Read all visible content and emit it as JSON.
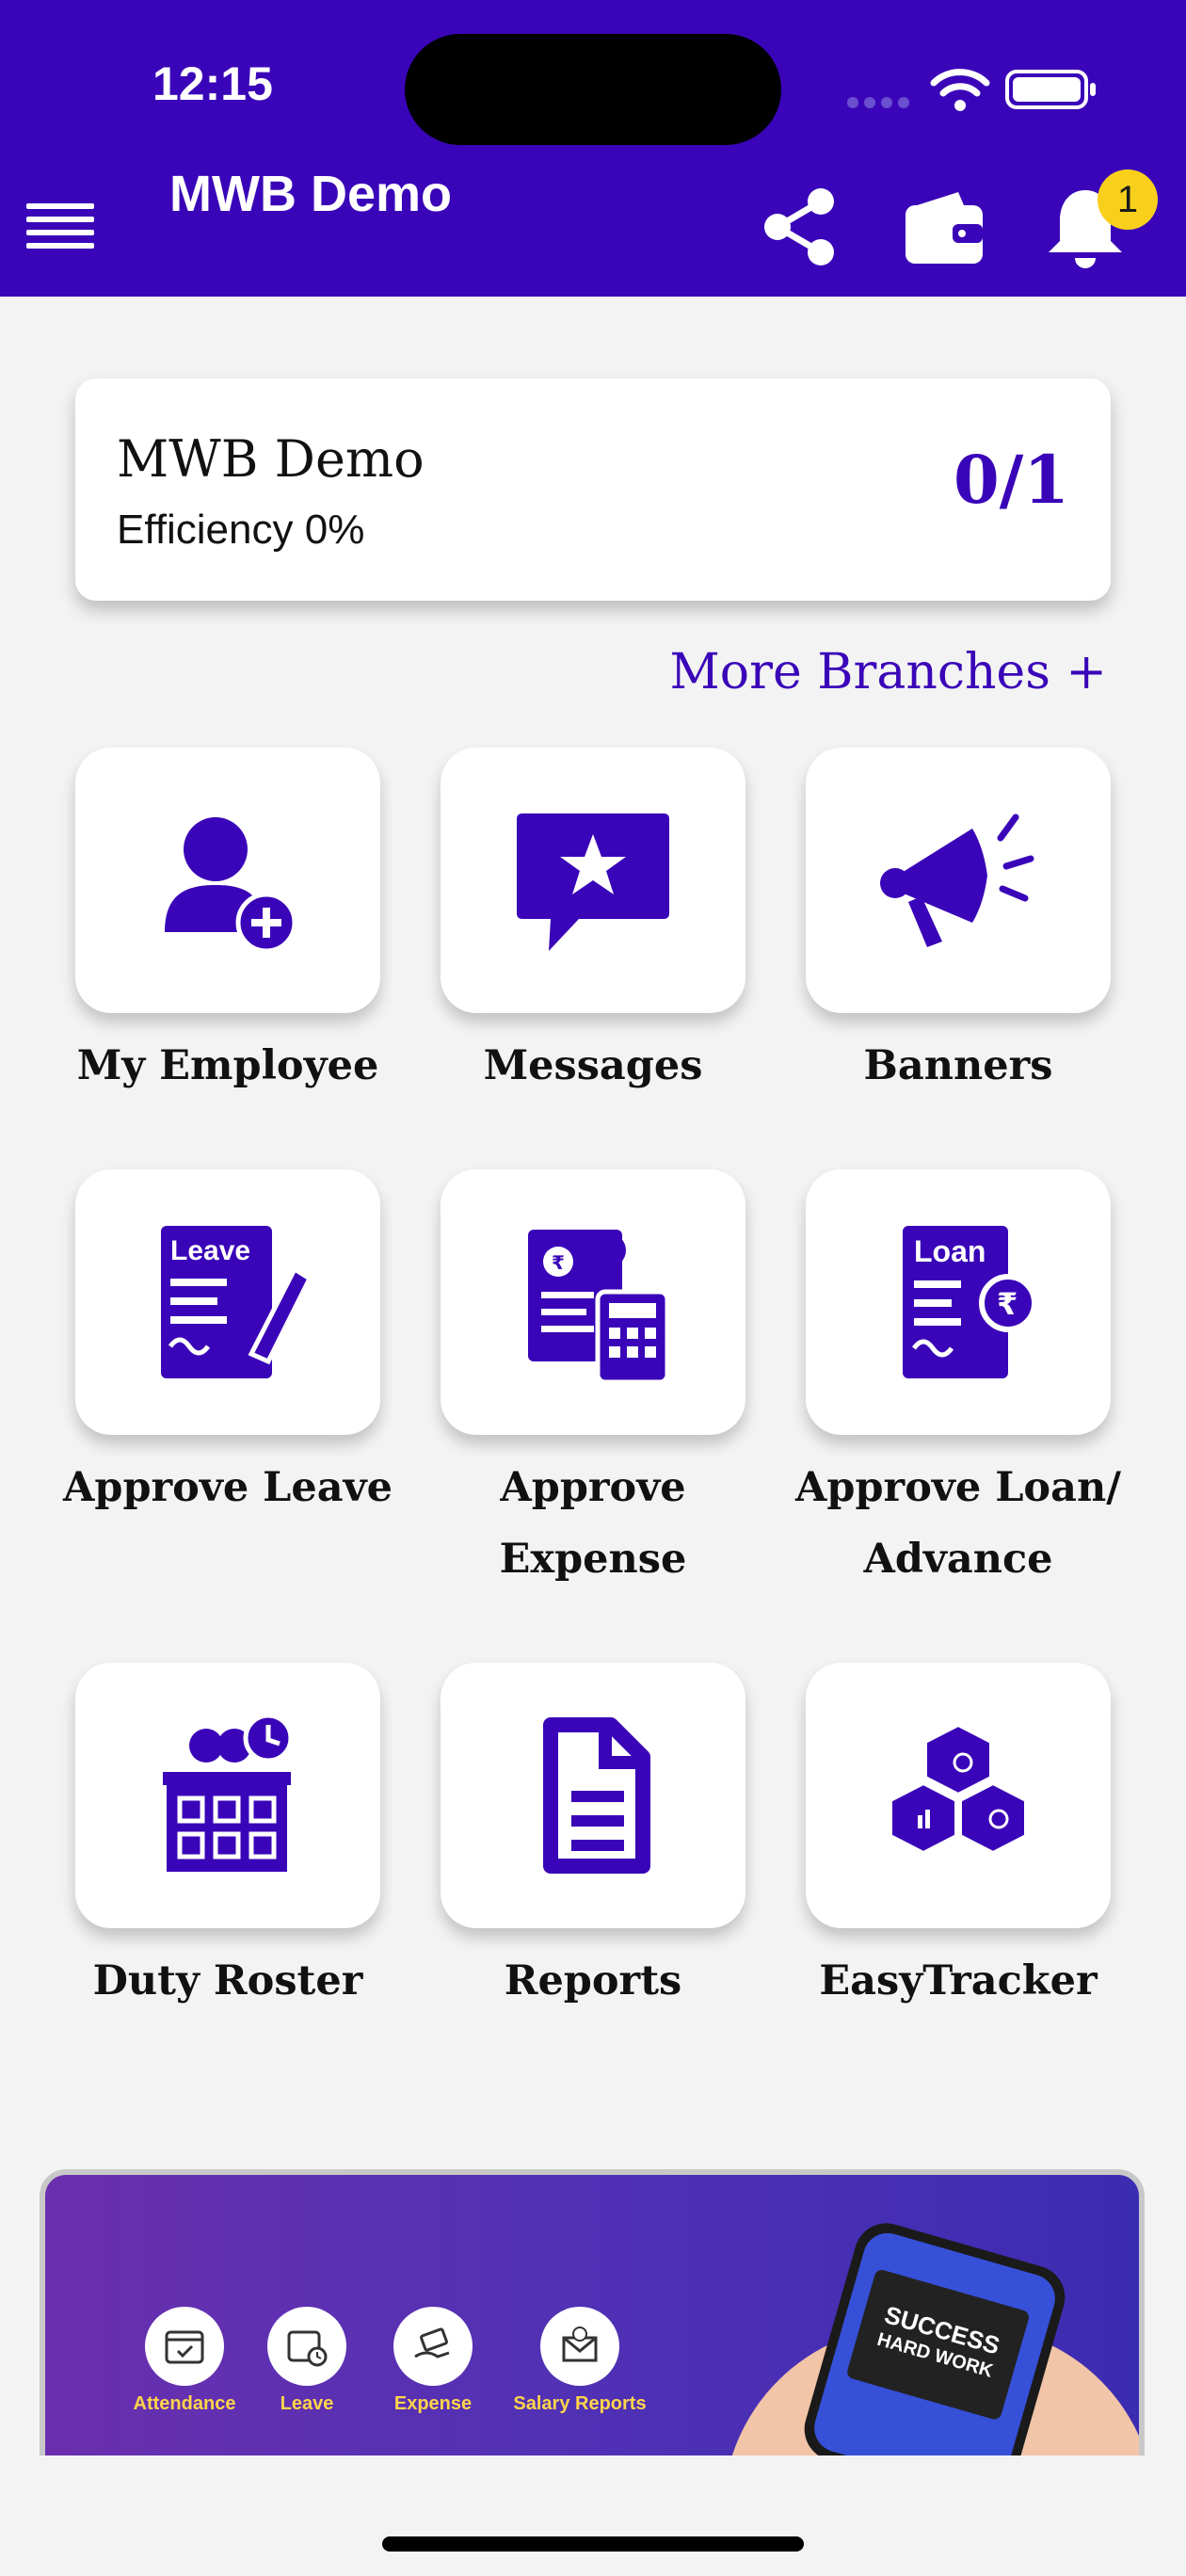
{
  "status_bar": {
    "time": "12:15"
  },
  "header": {
    "title": "MWB Demo",
    "notification_count": "1",
    "icons": [
      "menu-icon",
      "share-icon",
      "wallet-icon",
      "bell-icon"
    ]
  },
  "branch": {
    "name": "MWB Demo",
    "efficiency": "Efficiency 0%",
    "count": "0/1"
  },
  "more_branches": "More Branches +",
  "tiles": [
    {
      "label": "My Employee",
      "icon": "add-employee-icon"
    },
    {
      "label": "Messages",
      "icon": "message-star-icon"
    },
    {
      "label": "Banners",
      "icon": "megaphone-icon"
    },
    {
      "label": "Approve Leave",
      "icon": "leave-document-icon"
    },
    {
      "label": "Approve Expense",
      "icon": "expense-calculator-icon"
    },
    {
      "label": "Approve Loan/ Advance",
      "icon": "loan-document-icon"
    },
    {
      "label": "Duty Roster",
      "icon": "roster-icon"
    },
    {
      "label": "Reports",
      "icon": "report-document-icon"
    },
    {
      "label": "EasyTracker",
      "icon": "cubes-icon"
    }
  ],
  "banner": {
    "features": [
      "Attendance",
      "Leave",
      "Expense",
      "Salary Reports"
    ],
    "phone_text_1": "SUCCESS",
    "phone_text_2": "HARD WORK"
  },
  "colors": {
    "primary": "#3a05b8",
    "background": "#f3f3f3",
    "badge": "#f8d01b"
  }
}
